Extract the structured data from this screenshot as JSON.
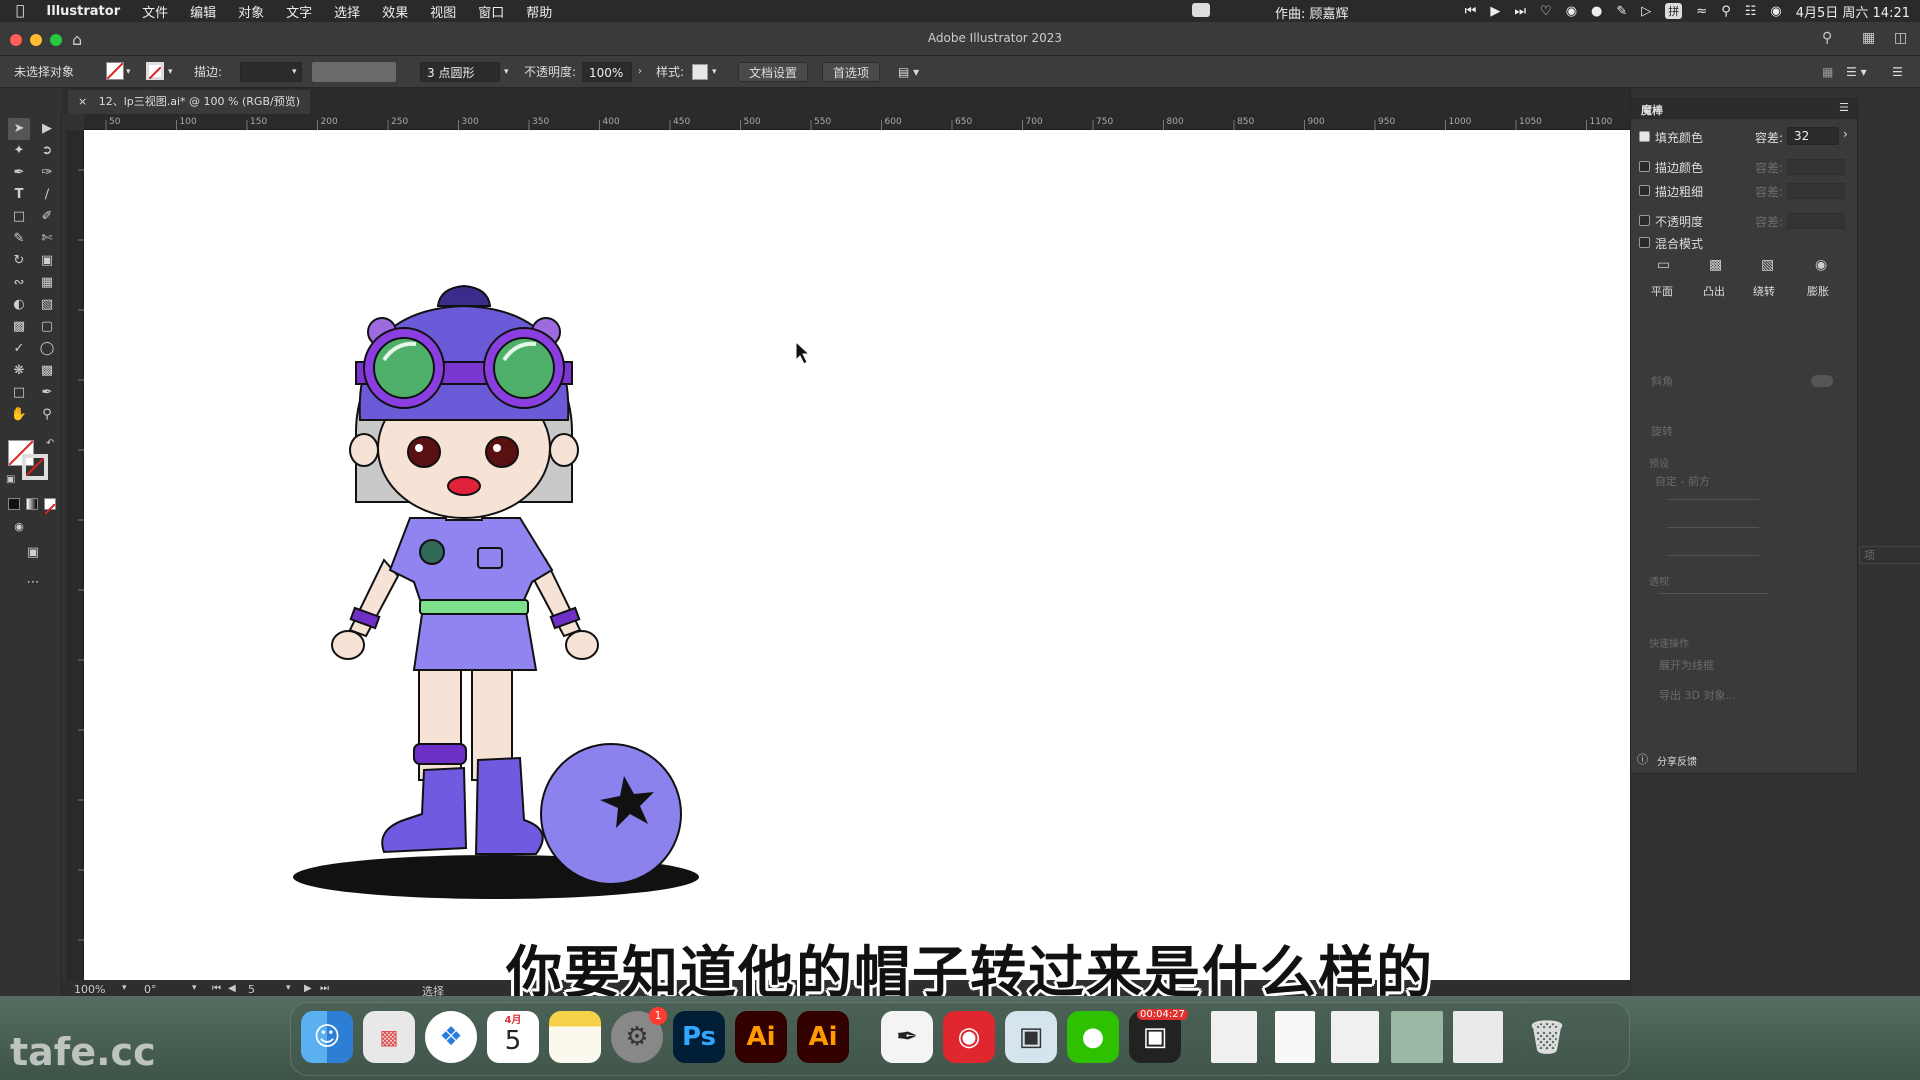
{
  "menubar": {
    "app_name": "Illustrator",
    "items": [
      "文件",
      "编辑",
      "对象",
      "文字",
      "选择",
      "效果",
      "视图",
      "窗口",
      "帮助"
    ],
    "author": "作曲: 顾嘉辉",
    "datetime": "4月5日 周六  14:21"
  },
  "window": {
    "title": "Adobe Illustrator 2023"
  },
  "controlbar": {
    "selection": "未选择对象",
    "stroke_label": "描边:",
    "brush": "3 点圆形",
    "opacity_label": "不透明度:",
    "opacity_value": "100%",
    "style_label": "样式:",
    "doc_settings": "文档设置",
    "preferences": "首选项"
  },
  "document": {
    "tab_title": "12、lp三视图.ai* @ 100 % (RGB/预览)"
  },
  "ruler": {
    "h_ticks": [
      "50",
      "100",
      "150",
      "200",
      "250",
      "300",
      "350",
      "400",
      "450",
      "500",
      "550",
      "600",
      "650",
      "700",
      "750",
      "800",
      "850",
      "900",
      "950",
      "1000",
      "1050",
      "1100"
    ]
  },
  "statusbar": {
    "zoom": "100%",
    "rotation": "0°",
    "artboard": "5",
    "tool": "选择"
  },
  "panel": {
    "title": "魔棒",
    "fill_color": "填充颜色",
    "tolerance_label": "容差:",
    "tolerance_value": "32",
    "stroke_color": "描边颜色",
    "stroke_weight": "描边粗细",
    "opacity": "不透明度",
    "blend_mode": "混合模式",
    "tolerance_dim": "容差:",
    "shape_buttons": [
      "平面",
      "凸出",
      "绕转",
      "膨胀"
    ],
    "section_bevel": "斜角",
    "section_rotate": "旋转",
    "preset": "预设",
    "preset_value": "自定 - 前方",
    "persp": "透视",
    "quick_actions": "快速操作",
    "expand": "展开为线框",
    "export3d": "导出 3D 对象...",
    "feedback": "分享反馈"
  },
  "subtitle": "你要知道他的帽子转过来是什么样的",
  "dock": {
    "calendar_month": "4月",
    "calendar_day": "5",
    "settings_badge": "1",
    "ps": "Ps",
    "ai": "Ai",
    "ai2": "Ai",
    "recorder_time": "00:04:27"
  },
  "watermark": "tafe.cc",
  "colors": {
    "hat": "#6a5ad8",
    "shirt": "#8f84f0",
    "boots": "#6f5ae0",
    "belt": "#7de08a",
    "hair": "#c9c9c9",
    "skin": "#f7e2d6",
    "ball": "#8b82ee"
  }
}
